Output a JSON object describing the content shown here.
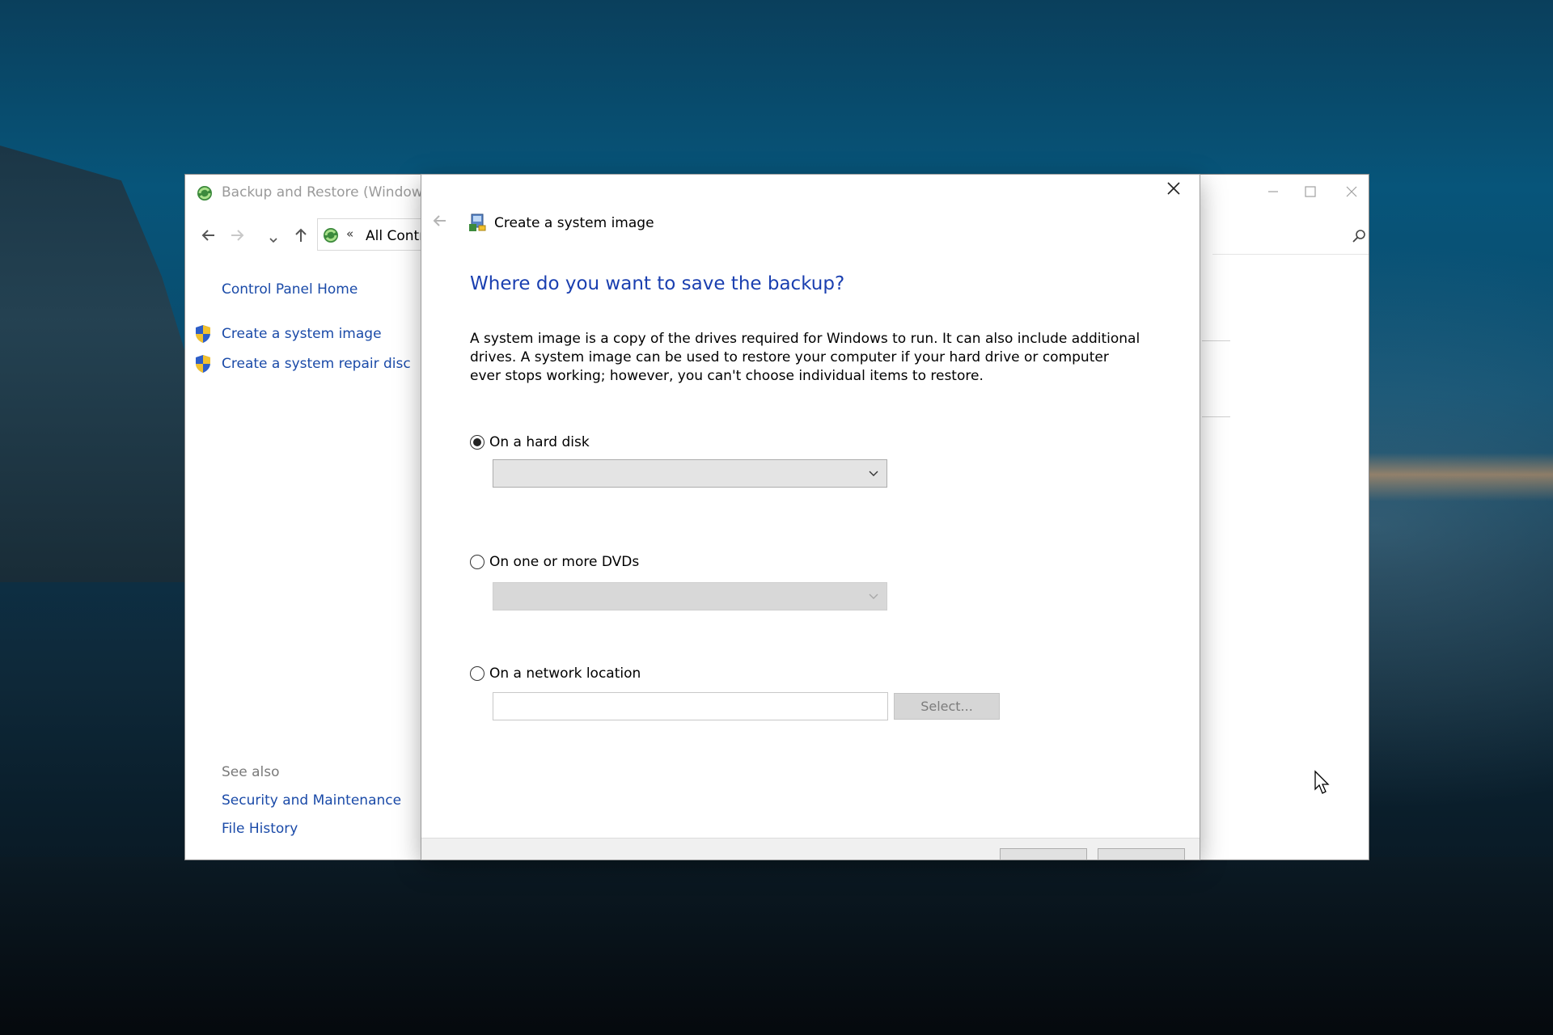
{
  "parent_window": {
    "title": "Backup and Restore (Windows",
    "address_chevrons": "«",
    "address_text": "All Contr",
    "left_nav": {
      "home": "Control Panel Home",
      "tasks": [
        "Create a system image",
        "Create a system repair disc"
      ],
      "see_also_label": "See also",
      "see_also": [
        "Security and Maintenance",
        "File History"
      ]
    }
  },
  "dialog": {
    "title": "Create a system image",
    "heading": "Where do you want to save the backup?",
    "description": "A system image is a copy of the drives required for Windows to run. It can also include additional drives. A system image can be used to restore your computer if your hard drive or computer ever stops working; however, you can't choose individual items to restore.",
    "options": [
      {
        "label": "On a hard disk",
        "selected": true
      },
      {
        "label": "On one or more DVDs",
        "selected": false
      },
      {
        "label": "On a network location",
        "selected": false
      }
    ],
    "hard_disk_value": "",
    "dvd_value": "",
    "network_location_value": "",
    "select_button": "Select..."
  },
  "colors": {
    "link": "#1a4aa8",
    "heading": "#1a3fb0"
  }
}
